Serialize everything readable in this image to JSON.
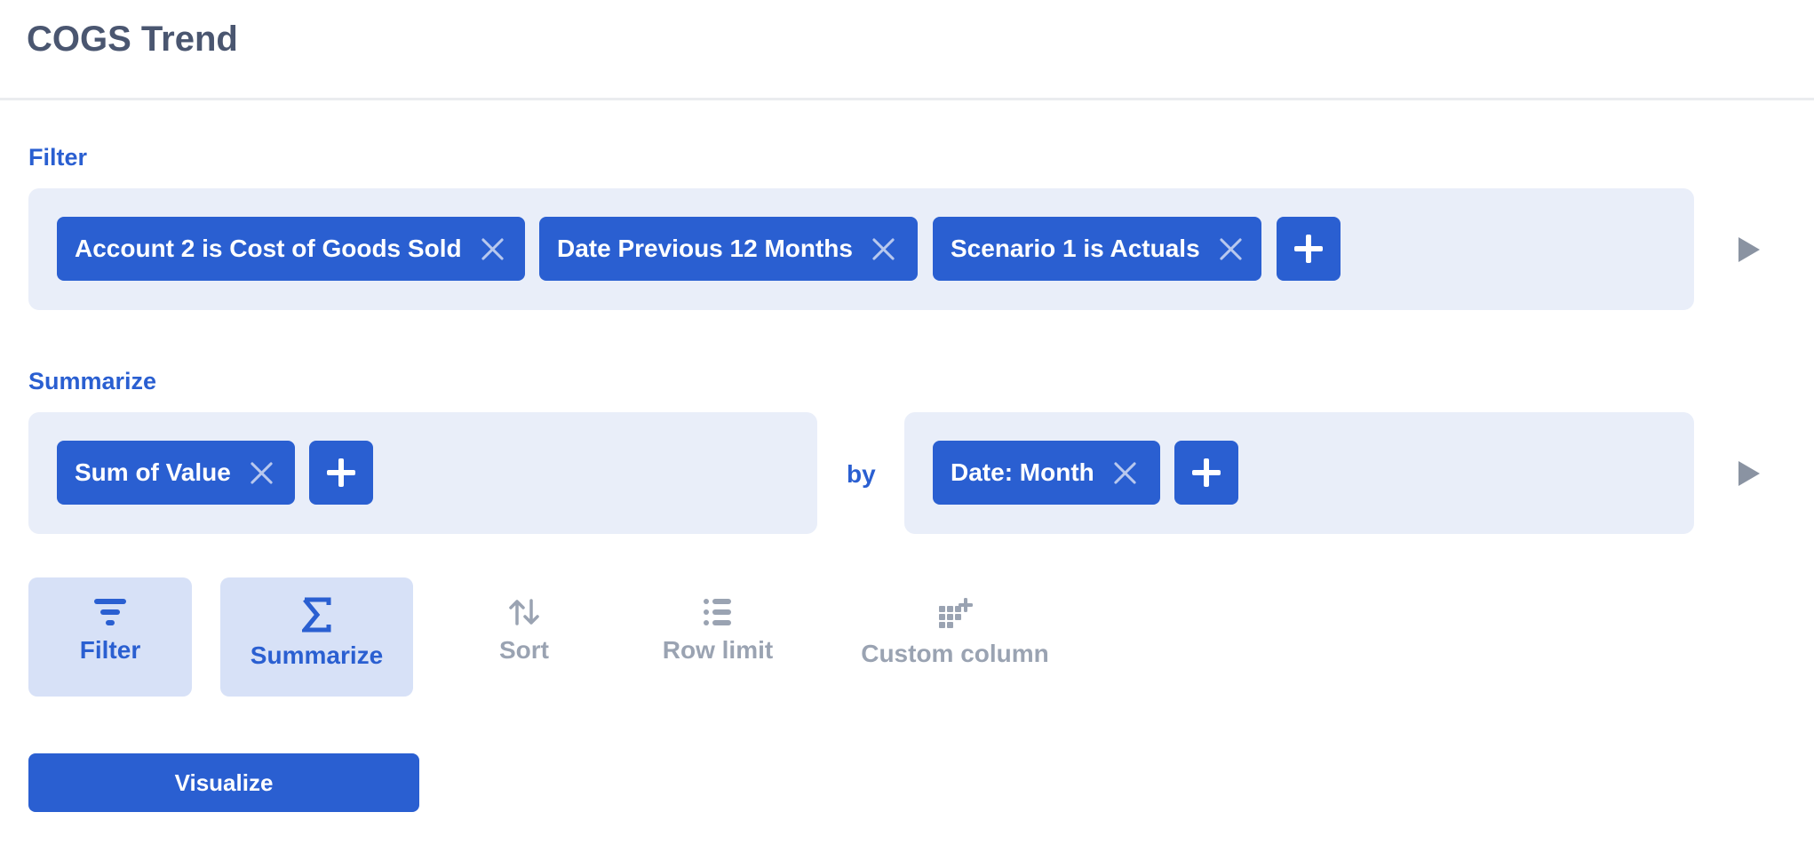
{
  "header": {
    "title": "COGS Trend"
  },
  "filter": {
    "label": "Filter",
    "chips": [
      {
        "label": "Account 2 is Cost of Goods Sold"
      },
      {
        "label": "Date Previous 12 Months"
      },
      {
        "label": "Scenario 1 is Actuals"
      }
    ]
  },
  "summarize": {
    "label": "Summarize",
    "metrics": [
      {
        "label": "Sum of Value"
      }
    ],
    "by_label": "by",
    "groupings": [
      {
        "label": "Date: Month"
      }
    ]
  },
  "steps": [
    {
      "label": "Filter",
      "icon": "filter-icon",
      "active": true
    },
    {
      "label": "Summarize",
      "icon": "sigma-icon",
      "active": true
    },
    {
      "label": "Sort",
      "icon": "sort-icon",
      "active": false
    },
    {
      "label": "Row limit",
      "icon": "list-icon",
      "active": false
    },
    {
      "label": "Custom column",
      "icon": "add-column-icon",
      "active": false
    }
  ],
  "actions": {
    "visualize_label": "Visualize"
  },
  "colors": {
    "accent": "#2a5fd1",
    "panel": "#e9eef9",
    "active_step": "#d7e1f7",
    "muted": "#9aa3b2",
    "title": "#4a5670"
  }
}
